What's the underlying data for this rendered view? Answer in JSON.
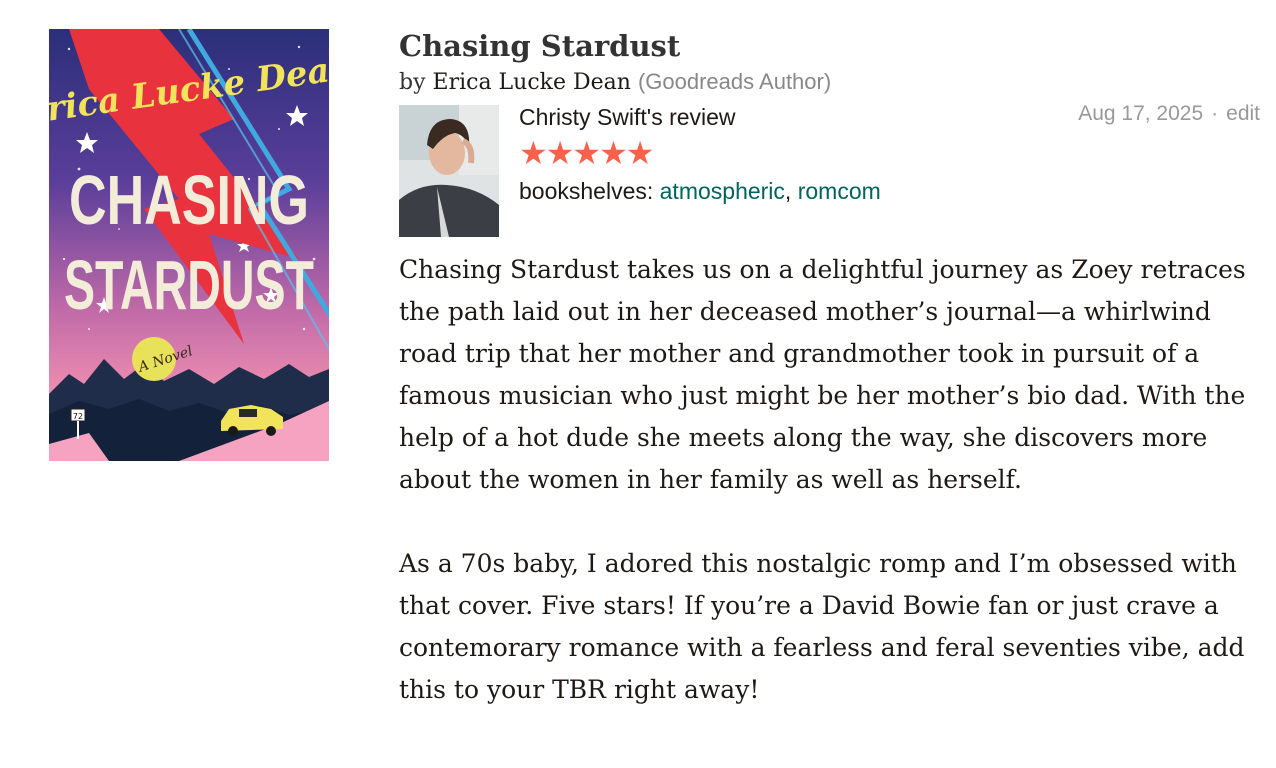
{
  "book": {
    "title": "Chasing Stardust",
    "by_label": "by",
    "author": "Erica Lucke Dean",
    "author_tag": "(Goodreads Author)",
    "cover": {
      "author_text": "Erica Lucke Dean",
      "title_line1": "CHASING",
      "title_line2": "STARDUST",
      "subtitle": "A Novel",
      "sign_number": "72"
    }
  },
  "review": {
    "reviewer_name": "Christy Swift",
    "reviewer_suffix": "'s review",
    "rating": 5,
    "stars": [
      "★",
      "★",
      "★",
      "★",
      "★"
    ],
    "shelves_label": "bookshelves: ",
    "shelves": [
      "atmospheric",
      "romcom"
    ],
    "shelf_separator": ", ",
    "date": "Aug 17, 2025",
    "date_separator": "·",
    "edit_label": "edit",
    "paragraphs": [
      "Chasing Stardust takes us on a delightful journey as Zoey retraces the path laid out in her deceased mother’s journal—a whirlwind road trip that her mother and grandmother took in pursuit of a famous musician who just might be her mother’s bio dad. With the help of a hot dude she meets along the way, she discovers more about the women in her family as well as herself.",
      "As a 70s baby, I adored this nostalgic romp and I’m obsessed with that cover. Five stars! If you’re a David Bowie fan or just crave a contemorary romance with a fearless and feral seventies vibe, add this to your TBR right away!"
    ]
  },
  "colors": {
    "star": "#fa604a",
    "shelf_link": "#00635d",
    "muted": "#999999",
    "author_tag": "#888888"
  },
  "icons": {
    "cover_image": "book-cover-image",
    "avatar": "reviewer-avatar-photo",
    "star": "star-icon"
  }
}
